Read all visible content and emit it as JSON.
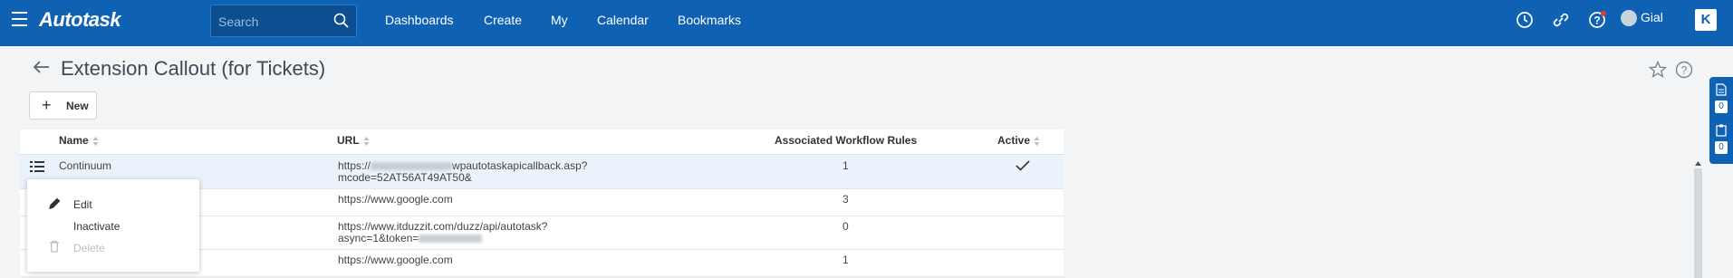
{
  "app": {
    "logo": "Autotask"
  },
  "search": {
    "placeholder": "Search"
  },
  "nav": [
    "Dashboards",
    "Create",
    "My",
    "Calendar",
    "Bookmarks"
  ],
  "user": {
    "name": "Gial"
  },
  "brand_badge": "K",
  "page": {
    "title": "Extension Callout (for Tickets)"
  },
  "toolbar": {
    "new_label": "New"
  },
  "table": {
    "headers": {
      "name": "Name",
      "url": "URL",
      "rules": "Associated Workflow Rules",
      "active": "Active"
    },
    "rows": [
      {
        "name": "Continuum",
        "url_line1": "https://",
        "url_line1_end": "wpautotaskapicallback.asp?",
        "url_line2": "mcode=52AT56AT49AT50&",
        "rules": "1",
        "active": true
      },
      {
        "name": "",
        "url_line1": "https://www.google.com",
        "rules": "3",
        "active": false
      },
      {
        "name": "",
        "url_line1": "https://www.itduzzit.com/duzz/api/autotask?",
        "url_line2": "async=1&token=",
        "rules": "0",
        "active": false
      },
      {
        "name": "",
        "url_line1": "https://www.google.com",
        "rules": "1",
        "active": false
      }
    ]
  },
  "context_menu": {
    "edit": "Edit",
    "inactivate": "Inactivate",
    "delete": "Delete"
  },
  "side_panel": {
    "count1": "0",
    "count2": "0"
  },
  "colors": {
    "topbar": "#0f62b3",
    "selected_row": "#eaf3fc"
  }
}
